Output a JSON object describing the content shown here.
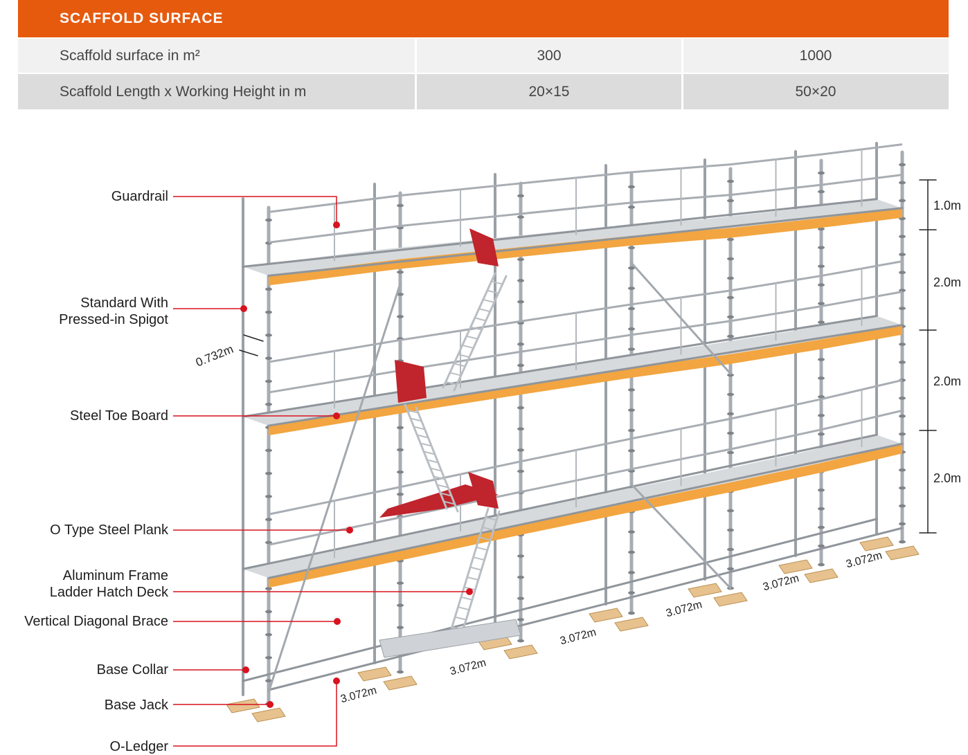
{
  "table": {
    "title": "SCAFFOLD SURFACE",
    "rows": [
      [
        "Scaffold surface in m²",
        "300",
        "1000"
      ],
      [
        "Scaffold  Length x Working Height in m",
        "20×15",
        "50×20"
      ]
    ]
  },
  "labels": {
    "guardrail": "Guardrail",
    "standard_1": "Standard With",
    "standard_2": "Pressed-in Spigot",
    "toe_board": "Steel Toe Board",
    "plank": "O Type Steel Plank",
    "hatch_1": "Aluminum Frame",
    "hatch_2": "Ladder Hatch Deck",
    "brace": "Vertical Diagonal Brace",
    "base_collar": "Base Collar",
    "base_jack": "Base Jack",
    "ledger": "O-Ledger"
  },
  "dimensions": {
    "width": "0.732m",
    "heights": [
      "1.0m",
      "2.0m",
      "2.0m",
      "2.0m"
    ],
    "bay_length": "3.072m"
  },
  "colors": {
    "accent": "#e65a0e",
    "callout": "#d8121e",
    "toe_board": "#f2a540",
    "hatch": "#c0242c",
    "steel": "#a8adb3"
  }
}
